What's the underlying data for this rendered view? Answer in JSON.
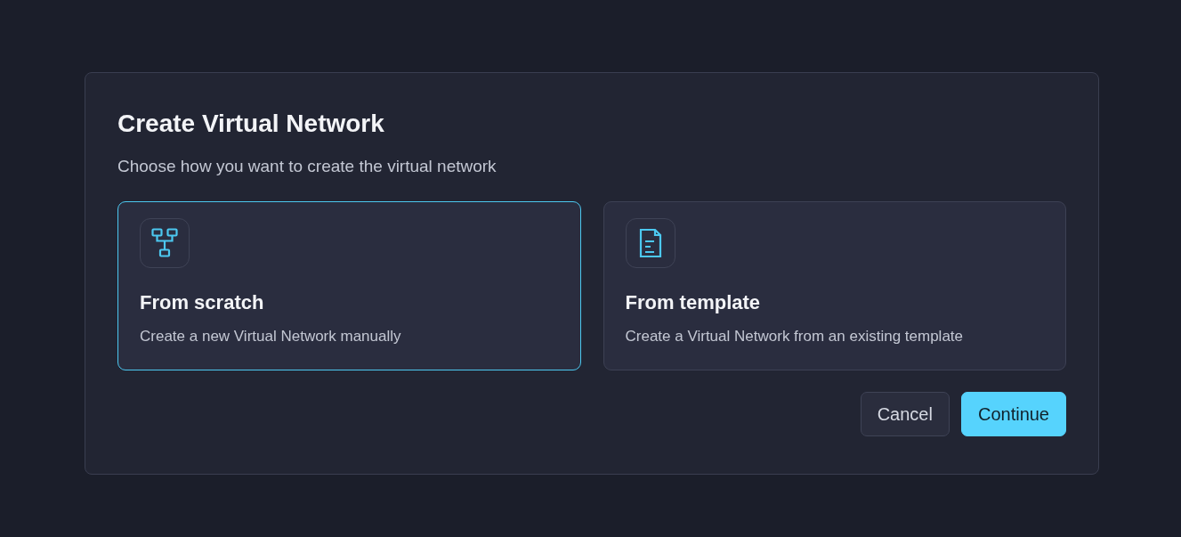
{
  "dialog": {
    "title": "Create Virtual Network",
    "subtitle": "Choose how you want to create the virtual network",
    "options": [
      {
        "kind": "network",
        "title": "From scratch",
        "description": "Create a new Virtual Network manually",
        "selected": true
      },
      {
        "kind": "document",
        "title": "From template",
        "description": "Create a Virtual Network from an existing template",
        "selected": false
      }
    ],
    "buttons": [
      {
        "kind": "secondary",
        "label": "Cancel"
      },
      {
        "kind": "primary",
        "label": "Continue"
      }
    ]
  }
}
